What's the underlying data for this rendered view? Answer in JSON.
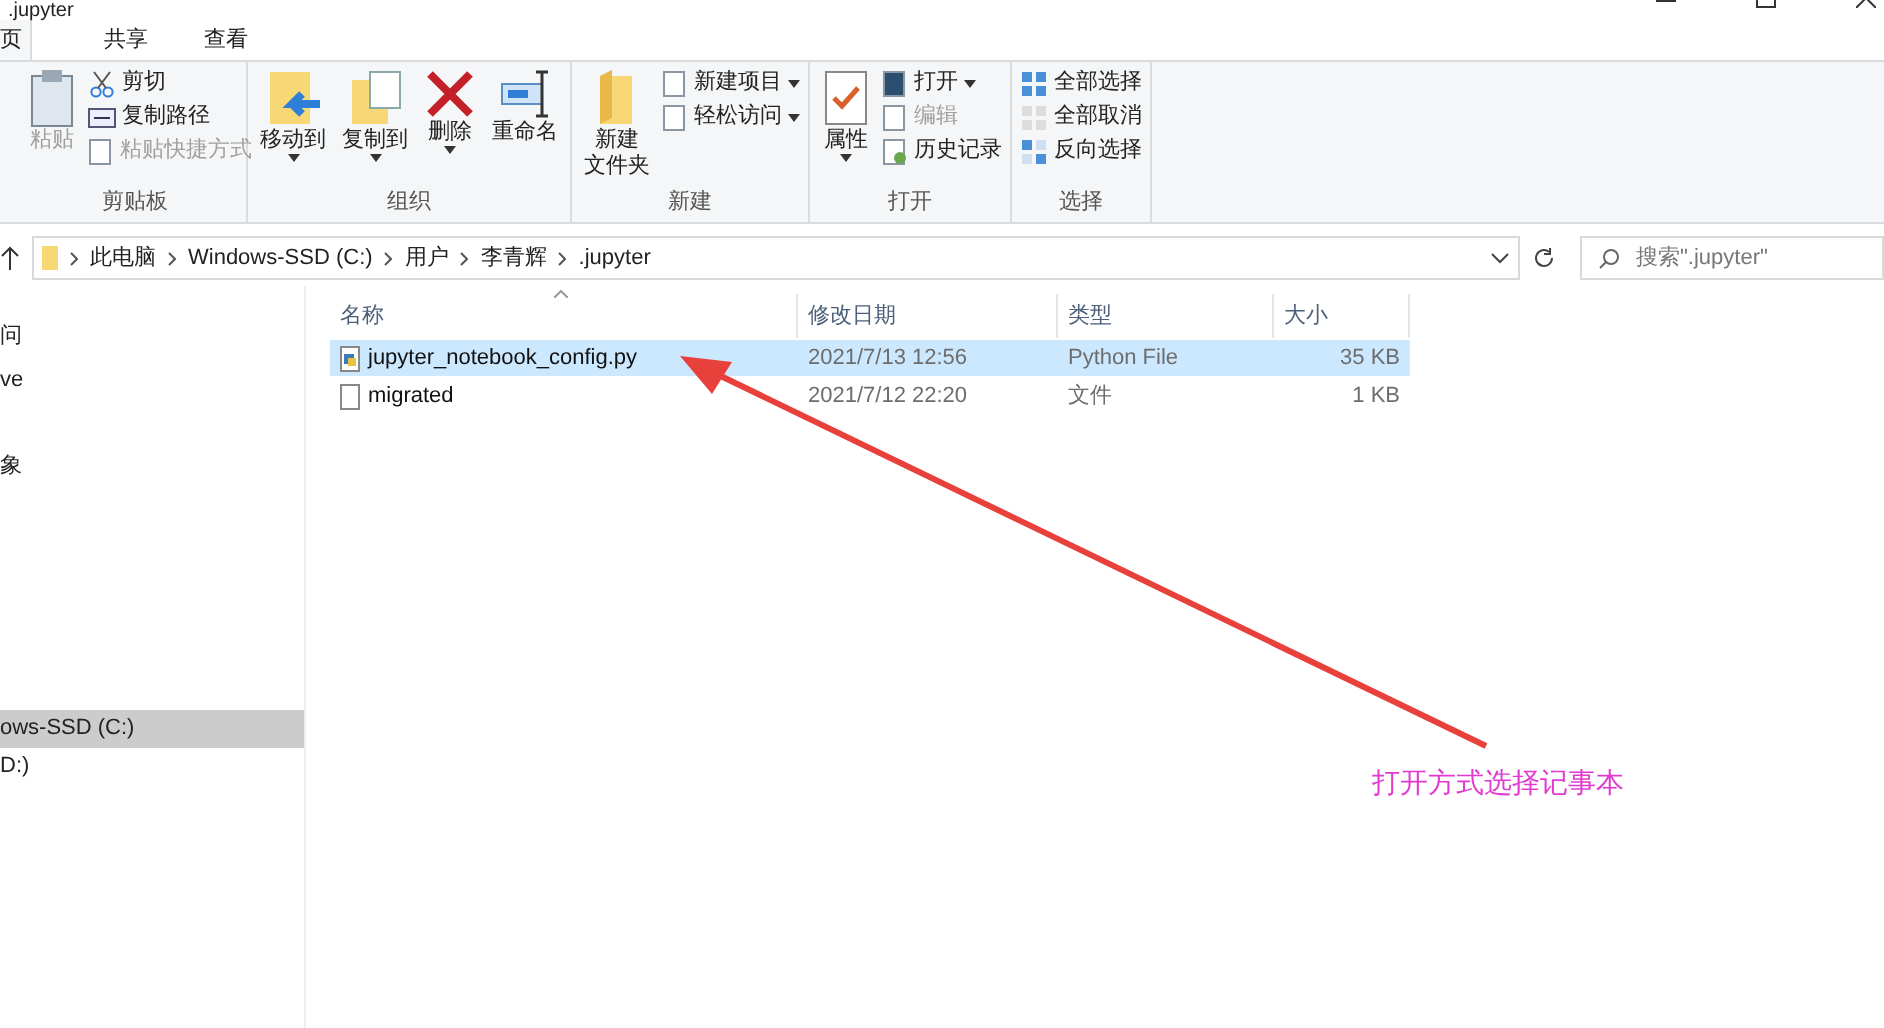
{
  "window": {
    "title": ".jupyter"
  },
  "tabs": [
    {
      "label": "页",
      "selected": true
    },
    {
      "label": "共享",
      "selected": false
    },
    {
      "label": "查看",
      "selected": false
    }
  ],
  "ribbon": [
    {
      "label": "剪贴板",
      "large": [
        {
          "kind": "paste",
          "lines": [
            "粘贴"
          ],
          "disabled": true,
          "dropdown": false
        }
      ],
      "small": [
        {
          "kind": "cut",
          "label": "剪切",
          "disabled": false,
          "dropdown": false
        },
        {
          "kind": "copypath",
          "label": "复制路径",
          "disabled": false,
          "dropdown": false
        },
        {
          "kind": "shortcut",
          "label": "粘贴快捷方式",
          "disabled": true,
          "dropdown": false
        }
      ]
    },
    {
      "label": "组织",
      "large": [
        {
          "kind": "move",
          "lines": [
            "移动到"
          ],
          "disabled": false,
          "dropdown": true
        },
        {
          "kind": "copy",
          "lines": [
            "复制到"
          ],
          "disabled": false,
          "dropdown": true
        },
        {
          "kind": "delete",
          "lines": [
            "删除"
          ],
          "disabled": false,
          "dropdown": true
        },
        {
          "kind": "rename",
          "lines": [
            "重命名"
          ],
          "disabled": false,
          "dropdown": false
        }
      ]
    },
    {
      "label": "新建",
      "large": [
        {
          "kind": "folder",
          "lines": [
            "新建",
            "文件夹"
          ],
          "disabled": false,
          "dropdown": false
        }
      ],
      "small": [
        {
          "kind": "newitem",
          "label": "新建项目",
          "disabled": false,
          "dropdown": true
        },
        {
          "kind": "easy",
          "label": "轻松访问",
          "disabled": false,
          "dropdown": true
        }
      ]
    },
    {
      "label": "打开",
      "large": [
        {
          "kind": "props",
          "lines": [
            "属性"
          ],
          "disabled": false,
          "dropdown": true
        }
      ],
      "small": [
        {
          "kind": "open",
          "label": "打开",
          "disabled": false,
          "dropdown": true
        },
        {
          "kind": "edit",
          "label": "编辑",
          "disabled": true,
          "dropdown": false
        },
        {
          "kind": "history",
          "label": "历史记录",
          "disabled": false,
          "dropdown": false
        }
      ]
    },
    {
      "label": "选择",
      "small": [
        {
          "kind": "selall",
          "label": "全部选择",
          "disabled": false,
          "dropdown": false
        },
        {
          "kind": "selnone",
          "label": "全部取消",
          "disabled": false,
          "dropdown": false
        },
        {
          "kind": "invert",
          "label": "反向选择",
          "disabled": false,
          "dropdown": false
        }
      ]
    }
  ],
  "address": {
    "path": [
      "此电脑",
      "Windows-SSD (C:)",
      "用户",
      "李青辉",
      ".jupyter"
    ]
  },
  "search": {
    "placeholder": "搜索\".jupyter\""
  },
  "sidebar": {
    "items": [
      {
        "label": "问",
        "selected": false
      },
      {
        "label": "ve",
        "selected": false
      },
      {
        "label": "象",
        "selected": false
      },
      {
        "label": "ows-SSD (C:)",
        "selected": true
      },
      {
        "label": "D:)",
        "selected": false
      }
    ]
  },
  "table": {
    "columns": [
      "名称",
      "修改日期",
      "类型",
      "大小"
    ],
    "rows": [
      {
        "kind": "python",
        "name": "jupyter_notebook_config.py",
        "date": "2021/7/13 12:56",
        "type": "Python File",
        "size": "35 KB",
        "selected": true
      },
      {
        "kind": "file",
        "name": "migrated",
        "date": "2021/7/12 22:20",
        "type": "文件",
        "size": "1 KB",
        "selected": false
      }
    ]
  },
  "annotation": {
    "text": "打开方式选择记事本"
  }
}
